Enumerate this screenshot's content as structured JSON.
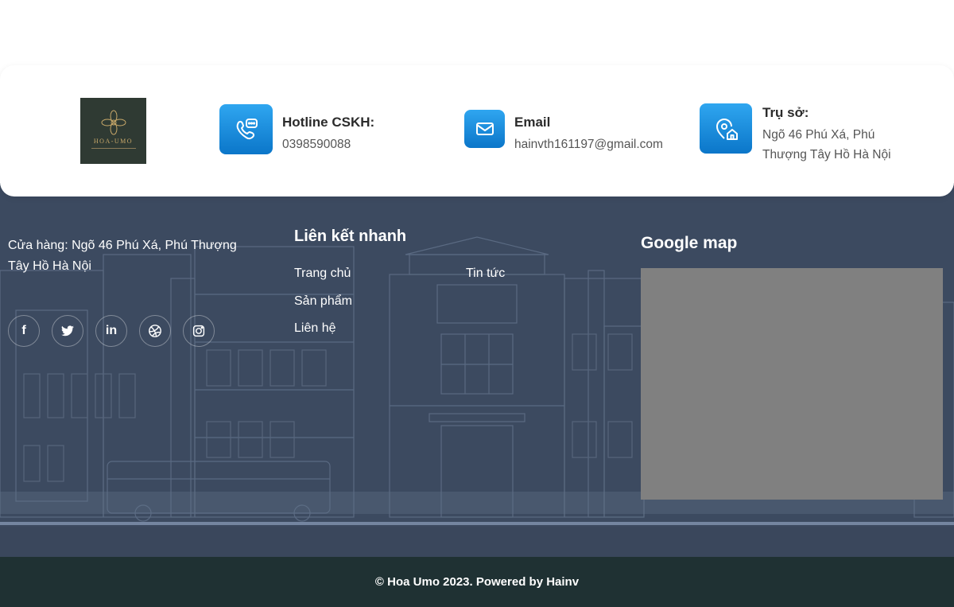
{
  "contact": {
    "logo_text": "HOA-UMO",
    "hotline": {
      "title": "Hotline CSKH:",
      "value": "0398590088"
    },
    "email": {
      "title": "Email",
      "value": "hainvth161197@gmail.com"
    },
    "office": {
      "title": "Trụ sở:",
      "line1": "Ngõ 46 Phú Xá, Phú",
      "line2": "Thượng Tây Hồ Hà Nội"
    }
  },
  "footer": {
    "store_line1": "Cửa hàng: Ngõ 46 Phú Xá, Phú Thượng",
    "store_line2": "Tây Hồ Hà Nội",
    "socials": [
      {
        "name": "facebook-icon",
        "glyph": "f"
      },
      {
        "name": "twitter-icon",
        "glyph": "🐦"
      },
      {
        "name": "linkedin-icon",
        "glyph": "in"
      },
      {
        "name": "dribbble-icon",
        "glyph": "◍"
      },
      {
        "name": "instagram-icon",
        "glyph": "◎"
      }
    ],
    "quick_links": {
      "title": "Liên kết nhanh",
      "items": [
        "Trang chủ",
        "Tin tức",
        "Sản phẩm",
        "Liên hệ"
      ]
    },
    "map": {
      "title": "Google map"
    }
  },
  "bottom": {
    "copyright": "© Hoa Umo 2023. Powered by Hainv"
  },
  "colors": {
    "footer_bg": "#3c4a60",
    "bottom_bg": "#1f3133",
    "icon_blue": "#1a8ee0",
    "map_gray": "#808080"
  }
}
